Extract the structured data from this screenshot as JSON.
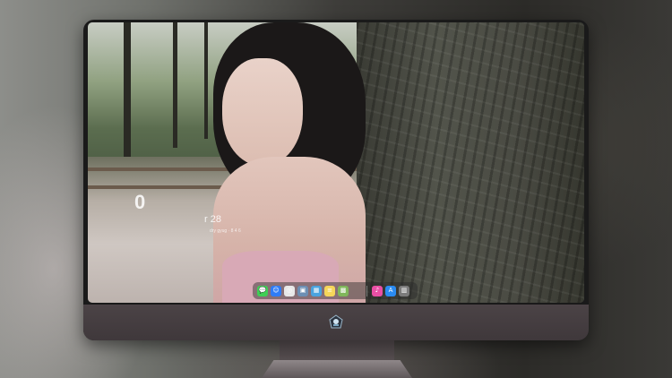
{
  "lockscreen": {
    "time": "0",
    "date": "r 28",
    "subtitle": "dry gyug · 8 4 6"
  },
  "dock": {
    "apps": [
      {
        "name": "messages-icon",
        "color": "#3fcf55",
        "glyph": "💬"
      },
      {
        "name": "finder-icon",
        "color": "#2f7cf6",
        "glyph": "☺"
      },
      {
        "name": "safari-icon",
        "color": "#e8e8e8",
        "glyph": "◎"
      },
      {
        "name": "preview-icon",
        "color": "#6d8fb4",
        "glyph": "▣"
      },
      {
        "name": "clapper-icon",
        "color": "#4aa3df",
        "glyph": "▦"
      },
      {
        "name": "notes-icon",
        "color": "#f5d65a",
        "glyph": "≡"
      },
      {
        "name": "photos-icon",
        "color": "#7fb65a",
        "glyph": "▩"
      },
      {
        "name": "itunes-icon",
        "color": "#e94fa5",
        "glyph": "♪"
      },
      {
        "name": "appstore-icon",
        "color": "#2a8bf2",
        "glyph": "A"
      },
      {
        "name": "trash-icon",
        "color": "#7b7b7b",
        "glyph": "▥"
      }
    ]
  },
  "colors": {
    "bezel": "#1a1a1a",
    "chin": "#4b4346",
    "accent": "#2f7cf6"
  }
}
